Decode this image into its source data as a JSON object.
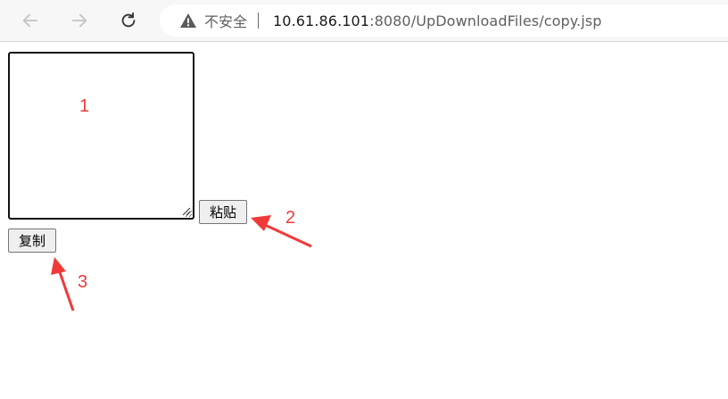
{
  "browser": {
    "back_icon": "arrow-left-icon",
    "forward_icon": "arrow-right-icon",
    "reload_icon": "reload-icon",
    "security_icon": "warning-triangle-icon",
    "security_label": "不安全",
    "url_host": "10.61.86.101",
    "url_rest": ":8080/UpDownloadFiles/copy.jsp"
  },
  "page": {
    "textarea_value": "",
    "paste_label": "粘贴",
    "copy_label": "复制"
  },
  "annotations": {
    "label_1": "1",
    "label_2": "2",
    "label_3": "3",
    "color": "#f03a3a"
  }
}
